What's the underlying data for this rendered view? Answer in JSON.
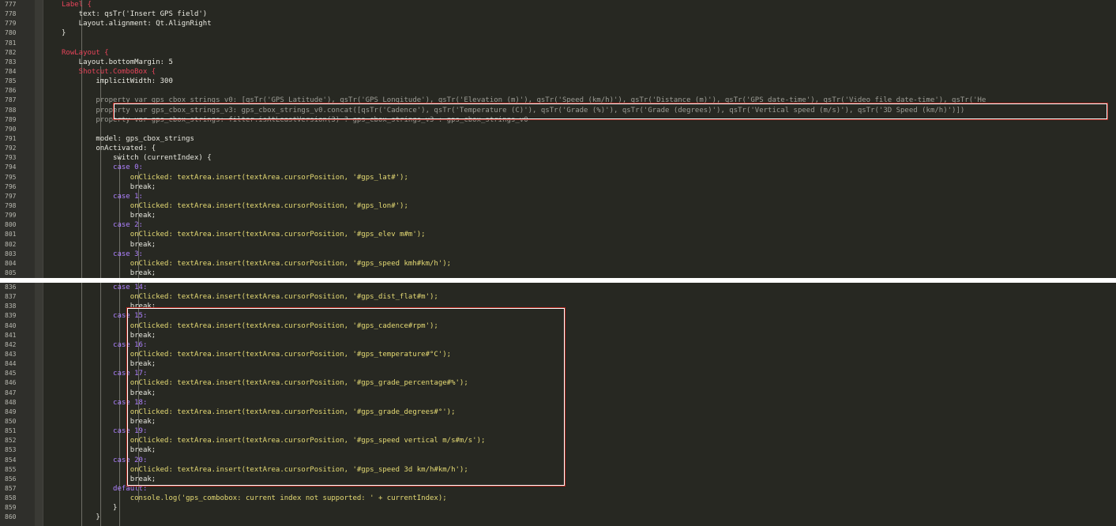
{
  "panels": [
    {
      "name": "top",
      "lines": [
        {
          "n": "777",
          "t": "Label {"
        },
        {
          "n": "778",
          "t": "    text: qsTr('Insert GPS field')"
        },
        {
          "n": "779",
          "t": "    Layout.alignment: Qt.AlignRight"
        },
        {
          "n": "780",
          "t": "}"
        },
        {
          "n": "781",
          "t": ""
        },
        {
          "n": "782",
          "t": "RowLayout {"
        },
        {
          "n": "783",
          "t": "    Layout.bottomMargin: 5"
        },
        {
          "n": "784",
          "t": "    Shotcut.ComboBox {"
        },
        {
          "n": "785",
          "t": "        implicitWidth: 300"
        },
        {
          "n": "786",
          "t": ""
        },
        {
          "n": "787",
          "t": "        property var gps_cbox_strings_v0: [qsTr('GPS Latitude'), qsTr('GPS Longitude'), qsTr('Elevation (m)'), qsTr('Speed (km/h)'), qsTr('Distance (m)'), qsTr('GPS date-time'), qsTr('Video file date-time'), qsTr('He"
        },
        {
          "n": "788",
          "t": "        property var gps_cbox_strings_v3: gps_cbox_strings_v0.concat([qsTr('Cadence'), qsTr('Temperature (C)'), qsTr('Grade (%)'), qsTr('Grade (degrees)'), qsTr('Vertical speed (m/s)'), qsTr('3D Speed (km/h)')])"
        },
        {
          "n": "789",
          "t": "        property var gps_cbox_strings: filter.isAtLeastVersion(3) ? gps_cbox_strings_v3 : gps_cbox_strings_v0"
        },
        {
          "n": "790",
          "t": ""
        },
        {
          "n": "791",
          "t": "        model: gps_cbox_strings"
        },
        {
          "n": "792",
          "t": "        onActivated: {"
        },
        {
          "n": "793",
          "t": "            switch (currentIndex) {"
        },
        {
          "n": "794",
          "t": "            case 0:"
        },
        {
          "n": "795",
          "t": "                onClicked: textArea.insert(textArea.cursorPosition, '#gps_lat#');"
        },
        {
          "n": "796",
          "t": "                break;"
        },
        {
          "n": "797",
          "t": "            case 1:"
        },
        {
          "n": "798",
          "t": "                onClicked: textArea.insert(textArea.cursorPosition, '#gps_lon#');"
        },
        {
          "n": "799",
          "t": "                break;"
        },
        {
          "n": "800",
          "t": "            case 2:"
        },
        {
          "n": "801",
          "t": "                onClicked: textArea.insert(textArea.cursorPosition, '#gps_elev m#m');"
        },
        {
          "n": "802",
          "t": "                break;"
        },
        {
          "n": "803",
          "t": "            case 3:"
        },
        {
          "n": "804",
          "t": "                onClicked: textArea.insert(textArea.cursorPosition, '#gps_speed kmh#km/h');"
        },
        {
          "n": "805",
          "t": "                break;"
        }
      ]
    },
    {
      "name": "bottom",
      "lines": [
        {
          "n": "836",
          "t": "            case 14:"
        },
        {
          "n": "837",
          "t": "                onClicked: textArea.insert(textArea.cursorPosition, '#gps_dist_flat#m');"
        },
        {
          "n": "838",
          "t": "                break;"
        },
        {
          "n": "839",
          "t": "            case 15:"
        },
        {
          "n": "840",
          "t": "                onClicked: textArea.insert(textArea.cursorPosition, '#gps_cadence#rpm');"
        },
        {
          "n": "841",
          "t": "                break;"
        },
        {
          "n": "842",
          "t": "            case 16:"
        },
        {
          "n": "843",
          "t": "                onClicked: textArea.insert(textArea.cursorPosition, '#gps_temperature#°C');"
        },
        {
          "n": "844",
          "t": "                break;"
        },
        {
          "n": "845",
          "t": "            case 17:"
        },
        {
          "n": "846",
          "t": "                onClicked: textArea.insert(textArea.cursorPosition, '#gps_grade_percentage#%');"
        },
        {
          "n": "847",
          "t": "                break;"
        },
        {
          "n": "848",
          "t": "            case 18:"
        },
        {
          "n": "849",
          "t": "                onClicked: textArea.insert(textArea.cursorPosition, '#gps_grade_degrees#°');"
        },
        {
          "n": "850",
          "t": "                break;"
        },
        {
          "n": "851",
          "t": "            case 19:"
        },
        {
          "n": "852",
          "t": "                onClicked: textArea.insert(textArea.cursorPosition, '#gps_speed vertical m/s#m/s');"
        },
        {
          "n": "853",
          "t": "                break;"
        },
        {
          "n": "854",
          "t": "            case 20:"
        },
        {
          "n": "855",
          "t": "                onClicked: textArea.insert(textArea.cursorPosition, '#gps_speed 3d km/h#km/h');"
        },
        {
          "n": "856",
          "t": "                break;"
        },
        {
          "n": "857",
          "t": "            default:"
        },
        {
          "n": "858",
          "t": "                console.log('gps_combobox: current index not supported: ' + currentIndex);"
        },
        {
          "n": "859",
          "t": "            }"
        },
        {
          "n": "860",
          "t": "        }"
        }
      ]
    }
  ],
  "colors": {
    "editor_bg": "#272822",
    "highlight_border": "#b0241b"
  }
}
